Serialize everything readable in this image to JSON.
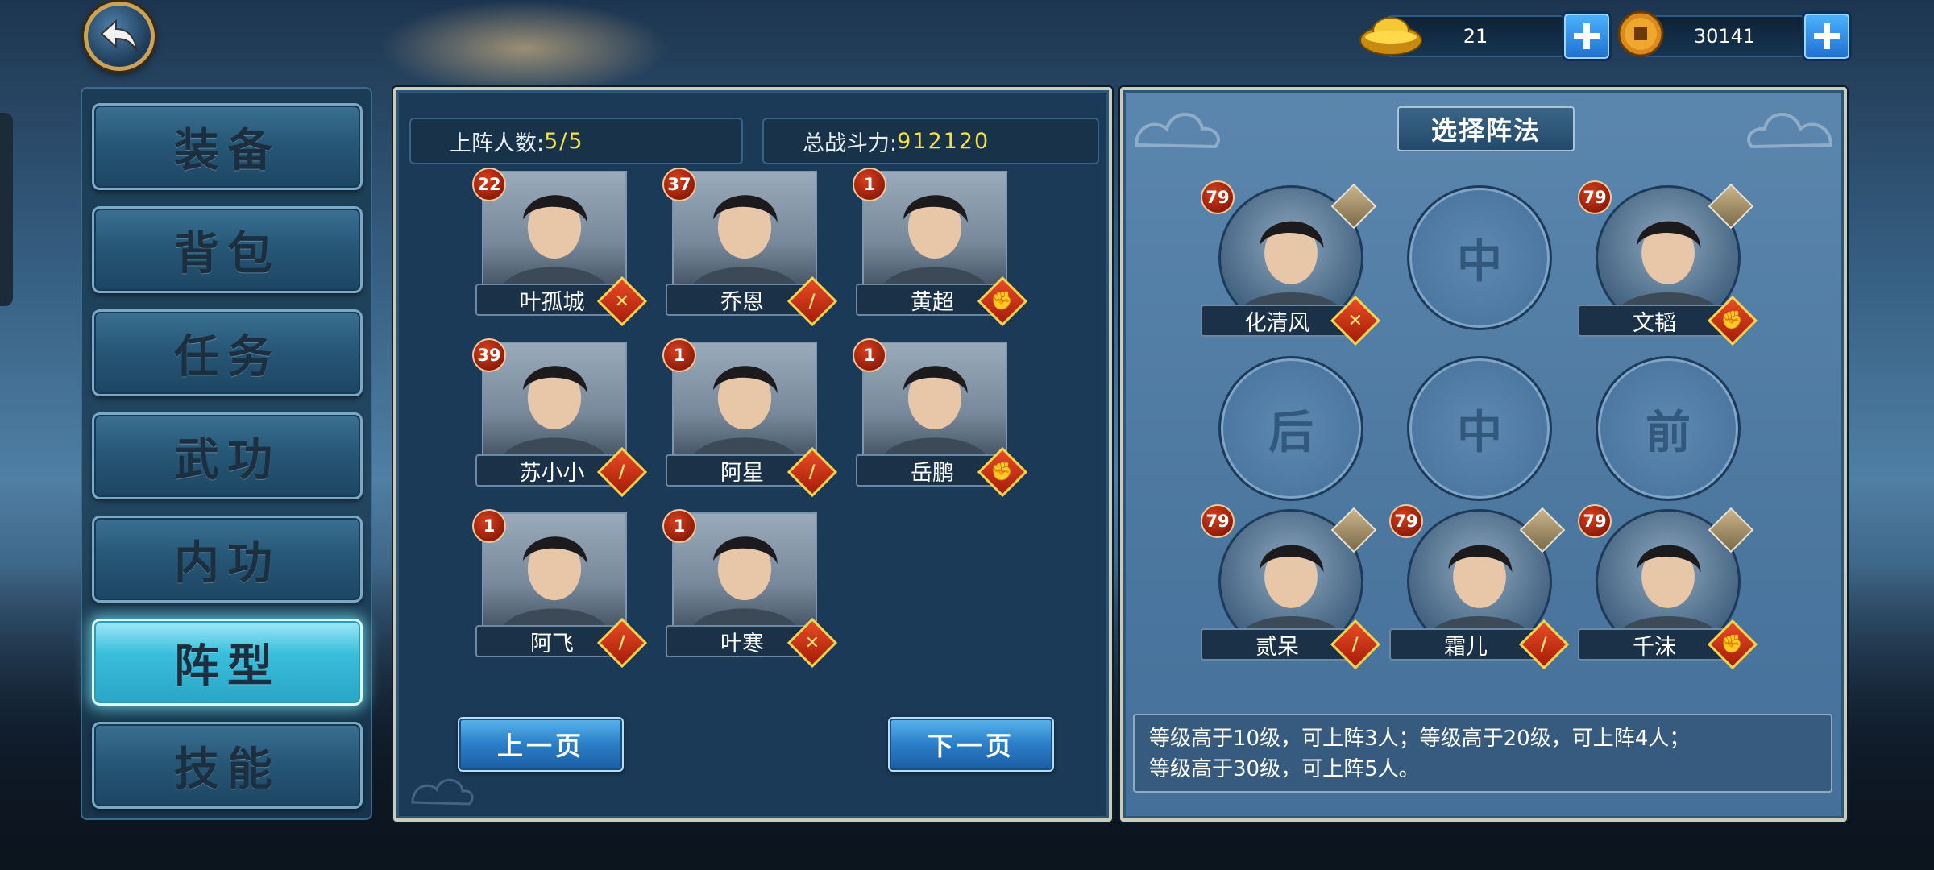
{
  "currency": {
    "gold": "21",
    "coins": "30141"
  },
  "menu": {
    "items": [
      {
        "label": "装备"
      },
      {
        "label": "背包"
      },
      {
        "label": "任务"
      },
      {
        "label": "武功"
      },
      {
        "label": "内功"
      },
      {
        "label": "阵型",
        "active": true
      },
      {
        "label": "技能"
      }
    ]
  },
  "team": {
    "count_label": "上阵人数:",
    "count_value": "5/5",
    "power_label": "总战斗力:",
    "power_value": "912120"
  },
  "roster": [
    {
      "name": "叶孤城",
      "level": "22",
      "type": "sword"
    },
    {
      "name": "乔恩",
      "level": "37",
      "type": "blade"
    },
    {
      "name": "黄超",
      "level": "1",
      "type": "fist"
    },
    {
      "name": "苏小小",
      "level": "39",
      "type": "blade"
    },
    {
      "name": "阿星",
      "level": "1",
      "type": "blade"
    },
    {
      "name": "岳鹏",
      "level": "1",
      "type": "fist"
    },
    {
      "name": "阿飞",
      "level": "1",
      "type": "blade"
    },
    {
      "name": "叶寒",
      "level": "1",
      "type": "sword"
    }
  ],
  "pagination": {
    "prev": "上一页",
    "next": "下一页"
  },
  "formation": {
    "title": "选择阵法",
    "slots_empty": [
      "中",
      "后",
      "中",
      "前"
    ],
    "heroes": [
      {
        "name": "化清风",
        "level": "79",
        "type": "sword"
      },
      {
        "name": "文韬",
        "level": "79",
        "type": "fist"
      },
      {
        "name": "贰呆",
        "level": "79",
        "type": "blade"
      },
      {
        "name": "霜儿",
        "level": "79",
        "type": "blade"
      },
      {
        "name": "千沫",
        "level": "79",
        "type": "fist"
      }
    ],
    "rule_line1": "等级高于10级，可上阵3人；等级高于20级，可上阵4人；",
    "rule_line2": "等级高于30级，可上阵5人。"
  },
  "colors": {
    "accent_yellow": "#f4e14a",
    "badge_red": "#d8401f",
    "active_tab": "#39bedb"
  },
  "icons": {
    "back": "back-arrow-icon",
    "gold": "gold-ingot-icon",
    "coin": "copper-coin-icon",
    "plus": "plus-icon",
    "sword": "crossed-swords-icon",
    "blade": "blade-icon",
    "fist": "fist-icon",
    "pet": "pet-icon"
  }
}
